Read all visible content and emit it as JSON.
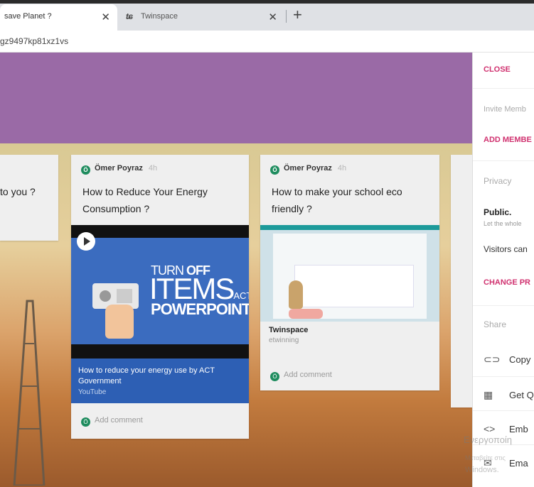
{
  "browser": {
    "tabs": [
      {
        "title": "save Planet ?",
        "close": "✕"
      },
      {
        "favicon": "ʨ",
        "title": "Twinspace",
        "close": "✕"
      }
    ],
    "new_tab": "+",
    "url": "gz9497kp81xz1vs"
  },
  "cards": [
    {
      "title": "to you ?"
    },
    {
      "author": "Ömer Poyraz",
      "age": "4h",
      "avatar": "Ö",
      "title": "How to Reduce Your Energy Consumption ?",
      "media": {
        "line1_light": "TURN ",
        "line1_bold": "OFF",
        "line2": "ITEMS",
        "line2_small": "ACT",
        "line3": "POWERPOINT"
      },
      "link_title": "How to reduce your energy use by ACT Government",
      "link_source": "YouTube",
      "comment": "Add comment"
    },
    {
      "author": "Ömer Poyraz",
      "age": "4h",
      "avatar": "Ö",
      "title": "How to make your school eco friendly ?",
      "site_name": "Twinspace",
      "site_source": "etwinning",
      "comment": "Add comment"
    }
  ],
  "panel": {
    "close": "CLOSE",
    "invite": "Invite Memb",
    "add": "ADD MEMBE",
    "privacy": "Privacy",
    "public": "Public.",
    "public_sub": "Let the whole",
    "visitors": "Visitors can",
    "change": "CHANGE PR",
    "share": "Share",
    "copy": "Copy",
    "get": "Get Q",
    "embed": "Emb",
    "email": "Ema"
  },
  "watermark": {
    "line1": "Ενεργοποίη",
    "line2": "Μεταβείτε στις",
    "line3": "Windows."
  }
}
